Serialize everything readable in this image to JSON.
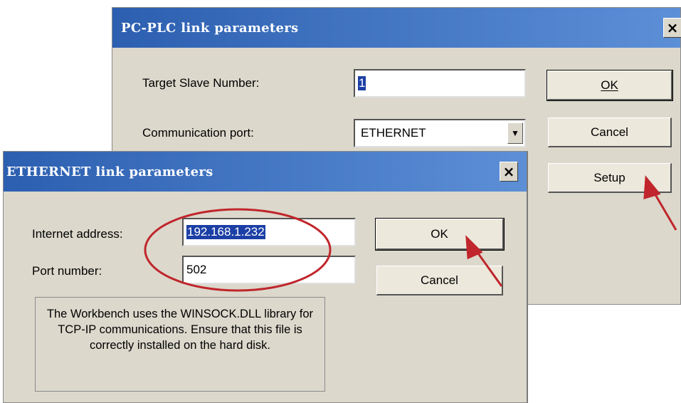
{
  "plc_dialog": {
    "title": "PC-PLC link parameters",
    "close_glyph": "×",
    "target_label": "Target Slave Number:",
    "target_value": "1",
    "port_label": "Communication port:",
    "port_value": "ETHERNET",
    "ok_label": "OK",
    "cancel_label": "Cancel",
    "setup_label": "Setup"
  },
  "eth_dialog": {
    "title": "ETHERNET link parameters",
    "close_glyph": "×",
    "ip_label": "Internet address:",
    "ip_value": "192.168.1.232",
    "port_label": "Port number:",
    "port_value": "502",
    "ok_label": "OK",
    "cancel_label": "Cancel",
    "info_text": "The Workbench uses the WINSOCK.DLL library for TCP-IP communications. Ensure that this file is correctly installed on the hard disk."
  },
  "icons": {
    "close": "close-icon",
    "dropdown": "chevron-down-icon"
  },
  "colors": {
    "titlebar": "#2c5fb0",
    "annotation": "#c0262c",
    "selection": "#1c3fa6"
  }
}
